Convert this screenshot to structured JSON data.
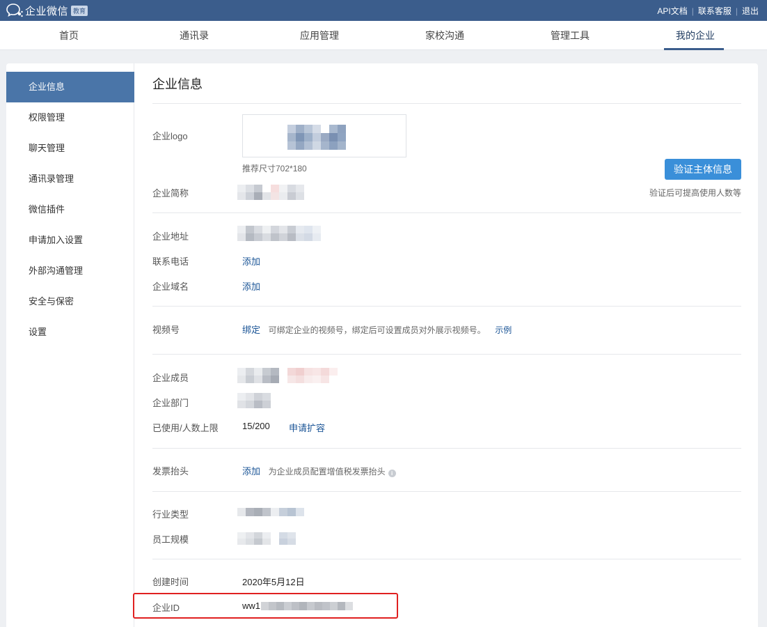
{
  "topbar": {
    "brand_name": "企业微信",
    "brand_badge": "教育",
    "links": [
      "API文档",
      "联系客服",
      "退出"
    ]
  },
  "nav": {
    "items": [
      "首页",
      "通讯录",
      "应用管理",
      "家校沟通",
      "管理工具",
      "我的企业"
    ],
    "active": "我的企业"
  },
  "sidebar": {
    "items": [
      "企业信息",
      "权限管理",
      "聊天管理",
      "通讯录管理",
      "微信插件",
      "申请加入设置",
      "外部沟通管理",
      "安全与保密",
      "设置"
    ],
    "active": "企业信息"
  },
  "page": {
    "title": "企业信息",
    "logo_label": "企业logo",
    "logo_hint": "推荐尺寸702*180",
    "verify_button": "验证主体信息",
    "verify_note": "验证后可提高使用人数等",
    "short_name_label": "企业简称",
    "address_label": "企业地址",
    "phone_label": "联系电话",
    "phone_action": "添加",
    "domain_label": "企业域名",
    "domain_action": "添加",
    "video_label": "视频号",
    "video_action": "绑定",
    "video_desc": "可绑定企业的视频号，绑定后可设置成员对外展示视频号。",
    "video_example": "示例",
    "members_label": "企业成员",
    "departments_label": "企业部门",
    "usage_label": "已使用/人数上限",
    "usage_value": "15/200",
    "usage_action": "申请扩容",
    "invoice_label": "发票抬头",
    "invoice_action": "添加",
    "invoice_desc": "为企业成员配置增值税发票抬头",
    "industry_label": "行业类型",
    "staff_label": "员工规模",
    "created_label": "创建时间",
    "created_value": "2020年5月12日",
    "corp_id_label": "企业ID",
    "corp_id_visible": "ww1"
  },
  "colors": {
    "topbar": "#3b5d8c",
    "sidebar_active": "#4a75a8",
    "button": "#3a8fd9",
    "link": "#1a5496",
    "highlight": "#e02020"
  }
}
